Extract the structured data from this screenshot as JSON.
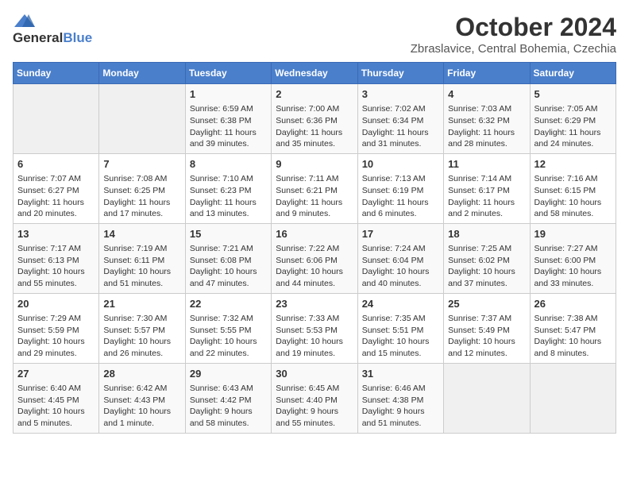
{
  "logo": {
    "general": "General",
    "blue": "Blue"
  },
  "title": "October 2024",
  "location": "Zbraslavice, Central Bohemia, Czechia",
  "days_of_week": [
    "Sunday",
    "Monday",
    "Tuesday",
    "Wednesday",
    "Thursday",
    "Friday",
    "Saturday"
  ],
  "weeks": [
    [
      {
        "day": "",
        "empty": true
      },
      {
        "day": "",
        "empty": true
      },
      {
        "day": "1",
        "sunrise": "Sunrise: 6:59 AM",
        "sunset": "Sunset: 6:38 PM",
        "daylight": "Daylight: 11 hours and 39 minutes."
      },
      {
        "day": "2",
        "sunrise": "Sunrise: 7:00 AM",
        "sunset": "Sunset: 6:36 PM",
        "daylight": "Daylight: 11 hours and 35 minutes."
      },
      {
        "day": "3",
        "sunrise": "Sunrise: 7:02 AM",
        "sunset": "Sunset: 6:34 PM",
        "daylight": "Daylight: 11 hours and 31 minutes."
      },
      {
        "day": "4",
        "sunrise": "Sunrise: 7:03 AM",
        "sunset": "Sunset: 6:32 PM",
        "daylight": "Daylight: 11 hours and 28 minutes."
      },
      {
        "day": "5",
        "sunrise": "Sunrise: 7:05 AM",
        "sunset": "Sunset: 6:29 PM",
        "daylight": "Daylight: 11 hours and 24 minutes."
      }
    ],
    [
      {
        "day": "6",
        "sunrise": "Sunrise: 7:07 AM",
        "sunset": "Sunset: 6:27 PM",
        "daylight": "Daylight: 11 hours and 20 minutes."
      },
      {
        "day": "7",
        "sunrise": "Sunrise: 7:08 AM",
        "sunset": "Sunset: 6:25 PM",
        "daylight": "Daylight: 11 hours and 17 minutes."
      },
      {
        "day": "8",
        "sunrise": "Sunrise: 7:10 AM",
        "sunset": "Sunset: 6:23 PM",
        "daylight": "Daylight: 11 hours and 13 minutes."
      },
      {
        "day": "9",
        "sunrise": "Sunrise: 7:11 AM",
        "sunset": "Sunset: 6:21 PM",
        "daylight": "Daylight: 11 hours and 9 minutes."
      },
      {
        "day": "10",
        "sunrise": "Sunrise: 7:13 AM",
        "sunset": "Sunset: 6:19 PM",
        "daylight": "Daylight: 11 hours and 6 minutes."
      },
      {
        "day": "11",
        "sunrise": "Sunrise: 7:14 AM",
        "sunset": "Sunset: 6:17 PM",
        "daylight": "Daylight: 11 hours and 2 minutes."
      },
      {
        "day": "12",
        "sunrise": "Sunrise: 7:16 AM",
        "sunset": "Sunset: 6:15 PM",
        "daylight": "Daylight: 10 hours and 58 minutes."
      }
    ],
    [
      {
        "day": "13",
        "sunrise": "Sunrise: 7:17 AM",
        "sunset": "Sunset: 6:13 PM",
        "daylight": "Daylight: 10 hours and 55 minutes."
      },
      {
        "day": "14",
        "sunrise": "Sunrise: 7:19 AM",
        "sunset": "Sunset: 6:11 PM",
        "daylight": "Daylight: 10 hours and 51 minutes."
      },
      {
        "day": "15",
        "sunrise": "Sunrise: 7:21 AM",
        "sunset": "Sunset: 6:08 PM",
        "daylight": "Daylight: 10 hours and 47 minutes."
      },
      {
        "day": "16",
        "sunrise": "Sunrise: 7:22 AM",
        "sunset": "Sunset: 6:06 PM",
        "daylight": "Daylight: 10 hours and 44 minutes."
      },
      {
        "day": "17",
        "sunrise": "Sunrise: 7:24 AM",
        "sunset": "Sunset: 6:04 PM",
        "daylight": "Daylight: 10 hours and 40 minutes."
      },
      {
        "day": "18",
        "sunrise": "Sunrise: 7:25 AM",
        "sunset": "Sunset: 6:02 PM",
        "daylight": "Daylight: 10 hours and 37 minutes."
      },
      {
        "day": "19",
        "sunrise": "Sunrise: 7:27 AM",
        "sunset": "Sunset: 6:00 PM",
        "daylight": "Daylight: 10 hours and 33 minutes."
      }
    ],
    [
      {
        "day": "20",
        "sunrise": "Sunrise: 7:29 AM",
        "sunset": "Sunset: 5:59 PM",
        "daylight": "Daylight: 10 hours and 29 minutes."
      },
      {
        "day": "21",
        "sunrise": "Sunrise: 7:30 AM",
        "sunset": "Sunset: 5:57 PM",
        "daylight": "Daylight: 10 hours and 26 minutes."
      },
      {
        "day": "22",
        "sunrise": "Sunrise: 7:32 AM",
        "sunset": "Sunset: 5:55 PM",
        "daylight": "Daylight: 10 hours and 22 minutes."
      },
      {
        "day": "23",
        "sunrise": "Sunrise: 7:33 AM",
        "sunset": "Sunset: 5:53 PM",
        "daylight": "Daylight: 10 hours and 19 minutes."
      },
      {
        "day": "24",
        "sunrise": "Sunrise: 7:35 AM",
        "sunset": "Sunset: 5:51 PM",
        "daylight": "Daylight: 10 hours and 15 minutes."
      },
      {
        "day": "25",
        "sunrise": "Sunrise: 7:37 AM",
        "sunset": "Sunset: 5:49 PM",
        "daylight": "Daylight: 10 hours and 12 minutes."
      },
      {
        "day": "26",
        "sunrise": "Sunrise: 7:38 AM",
        "sunset": "Sunset: 5:47 PM",
        "daylight": "Daylight: 10 hours and 8 minutes."
      }
    ],
    [
      {
        "day": "27",
        "sunrise": "Sunrise: 6:40 AM",
        "sunset": "Sunset: 4:45 PM",
        "daylight": "Daylight: 10 hours and 5 minutes."
      },
      {
        "day": "28",
        "sunrise": "Sunrise: 6:42 AM",
        "sunset": "Sunset: 4:43 PM",
        "daylight": "Daylight: 10 hours and 1 minute."
      },
      {
        "day": "29",
        "sunrise": "Sunrise: 6:43 AM",
        "sunset": "Sunset: 4:42 PM",
        "daylight": "Daylight: 9 hours and 58 minutes."
      },
      {
        "day": "30",
        "sunrise": "Sunrise: 6:45 AM",
        "sunset": "Sunset: 4:40 PM",
        "daylight": "Daylight: 9 hours and 55 minutes."
      },
      {
        "day": "31",
        "sunrise": "Sunrise: 6:46 AM",
        "sunset": "Sunset: 4:38 PM",
        "daylight": "Daylight: 9 hours and 51 minutes."
      },
      {
        "day": "",
        "empty": true
      },
      {
        "day": "",
        "empty": true
      }
    ]
  ]
}
